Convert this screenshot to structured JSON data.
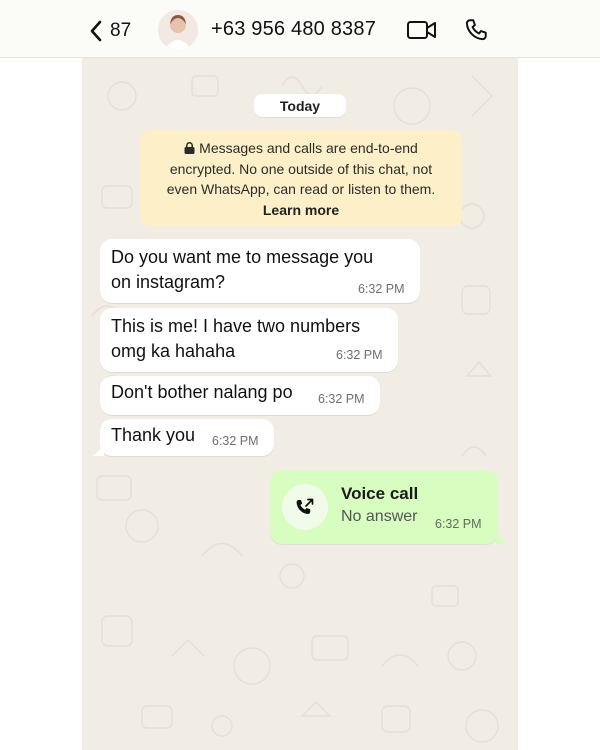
{
  "header": {
    "back_count": "87",
    "contact": "+63 956 480 8387",
    "icons": [
      "chevron-left-icon",
      "video-call-icon",
      "phone-icon"
    ]
  },
  "chat": {
    "date": "Today",
    "encryption": {
      "text": "Messages and calls are end-to-end encrypted. No one outside of this chat, not even WhatsApp, can read or listen to them.",
      "line1": "Messages and calls are end-to-end",
      "line2": "encrypted. No one outside of this chat, not",
      "line3": "even WhatsApp, can read or listen to them.",
      "link": "Learn more"
    },
    "messages": [
      {
        "direction": "incoming",
        "lines": [
          "Do you want me to message you",
          "on instagram?"
        ],
        "time": "6:32 PM"
      },
      {
        "direction": "incoming",
        "lines": [
          "This is me! I have two numbers",
          "omg ka hahaha"
        ],
        "time": "6:32 PM"
      },
      {
        "direction": "incoming",
        "lines": [
          "Don't bother nalang po"
        ],
        "time": "6:32 PM"
      },
      {
        "direction": "incoming",
        "lines": [
          "Thank you"
        ],
        "time": "6:32 PM"
      }
    ],
    "call": {
      "title": "Voice call",
      "status": "No answer",
      "time": "6:32 PM",
      "icon": "missed-outgoing-call-icon"
    }
  },
  "colors": {
    "wallpaper": "#f1ece4",
    "incoming_bubble": "#ffffff",
    "outgoing_bubble": "#d8fdc0",
    "encryption_notice": "#fdf0c9"
  }
}
